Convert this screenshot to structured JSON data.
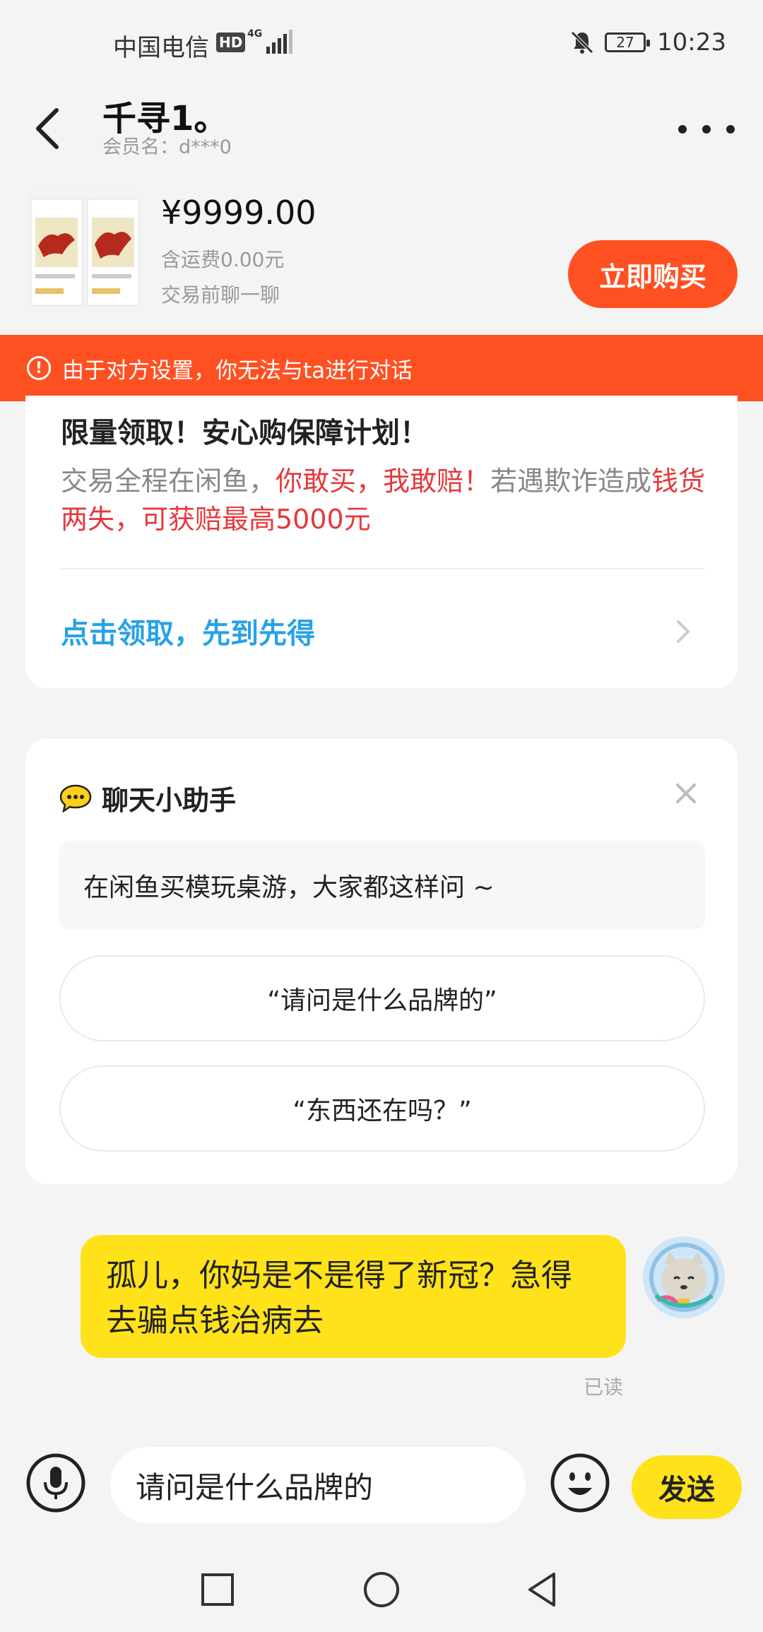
{
  "status_bar": {
    "carrier": "中国电信",
    "hd": "HD",
    "network": "4G",
    "battery": "27",
    "time": "10:23"
  },
  "header": {
    "title": "千寻1。",
    "member": "会员名：d***0"
  },
  "product": {
    "price": "¥9999.00",
    "shipping": "含运费0.00元",
    "chat_hint": "交易前聊一聊",
    "buy_label": "立即购买"
  },
  "warning": {
    "icon": "!",
    "text": "由于对方设置，你无法与ta进行对话"
  },
  "promo": {
    "heading": "限量领取！安心购保障计划！",
    "desc_1": "交易全程在闲鱼，",
    "desc_2": "你敢买，我敢赔！",
    "desc_3": "若遇欺诈造成",
    "desc_4": "钱货两失，可获赔最高5000元",
    "claim": "点击领取，先到先得"
  },
  "assistant": {
    "title": "聊天小助手",
    "tip": "在闲鱼买模玩桌游，大家都这样问 ~",
    "options": [
      "“请问是什么品牌的”",
      "“东西还在吗？”"
    ]
  },
  "message": {
    "text": "孤儿，你妈是不是得了新冠？急得去骗点钱治病去",
    "status": "已读"
  },
  "input": {
    "value": "请问是什么品牌的",
    "send_label": "发送"
  },
  "colors": {
    "accent_orange": "#ff5022",
    "accent_yellow": "#ffe21a",
    "link_blue": "#27a2e6",
    "alert_red": "#e4393c"
  }
}
